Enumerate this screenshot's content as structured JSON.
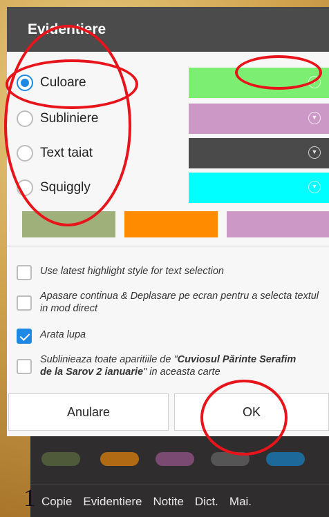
{
  "dialog": {
    "title": "Evidentiere",
    "styles": [
      {
        "label": "Culoare",
        "checked": true,
        "color": "#7cef73"
      },
      {
        "label": "Subliniere",
        "checked": false,
        "color": "#cc99c6"
      },
      {
        "label": "Text taiat",
        "checked": false,
        "color": "#4a4a4a"
      },
      {
        "label": "Squiggly",
        "checked": false,
        "color": "#00ffff"
      }
    ],
    "preset_colors": [
      "#9fb07b",
      "#ff8c00",
      "#cc99c6"
    ],
    "options": [
      {
        "checked": false,
        "text": "Use latest highlight style for text selection"
      },
      {
        "checked": false,
        "text": "Apasare continua & Deplasare pe ecran pentru a selecta textul in mod direct"
      },
      {
        "checked": true,
        "text": "Arata lupa"
      },
      {
        "checked": false,
        "text_prefix": "Sublinieaza toate aparitiile de \"",
        "text_bold": "Cuviosul Părinte Serafim de la Sarov 2 ianuarie",
        "text_suffix": "\" in aceasta carte"
      }
    ],
    "cancel_label": "Anulare",
    "ok_label": "OK"
  },
  "background": {
    "page_number": "1",
    "swatch_colors": [
      "#4e5a3a",
      "#b06a14",
      "#7a4a73",
      "#555555",
      "#1d6a9a"
    ],
    "menu": [
      "Copie",
      "Evidentiere",
      "Notite",
      "Dict.",
      "Mai."
    ]
  },
  "icons": {
    "dropdown": "chevron-down-circle-icon"
  },
  "annotation_color": "#e8141b"
}
